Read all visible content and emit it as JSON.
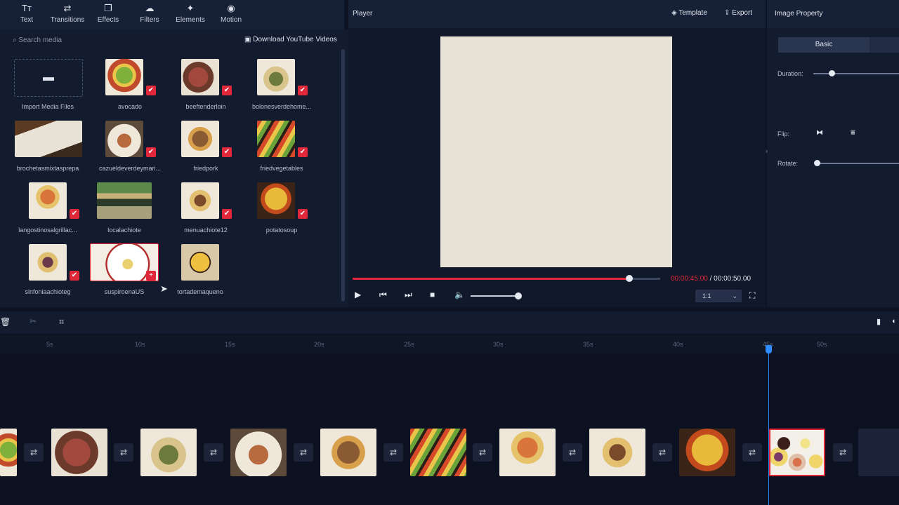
{
  "toolbar": {
    "items": [
      {
        "label": "Text",
        "icon": "text-icon"
      },
      {
        "label": "Transitions",
        "icon": "transitions-icon"
      },
      {
        "label": "Effects",
        "icon": "effects-icon"
      },
      {
        "label": "Filters",
        "icon": "filters-icon"
      },
      {
        "label": "Elements",
        "icon": "elements-icon"
      },
      {
        "label": "Motion",
        "icon": "motion-icon"
      }
    ]
  },
  "media": {
    "search_placeholder": "Search media",
    "download_link": "Download YouTube Videos",
    "import_label": "Import Media Files",
    "items": [
      {
        "label": "avocado",
        "checked": true
      },
      {
        "label": "beeftenderloin",
        "checked": true
      },
      {
        "label": "bolonesverdehome...",
        "checked": true
      },
      {
        "label": "brochetasmixtasprepa",
        "checked": false
      },
      {
        "label": "cazueldeverdeymari...",
        "checked": true
      },
      {
        "label": "friedpork",
        "checked": true
      },
      {
        "label": "friedvegetables",
        "checked": true
      },
      {
        "label": "langostinosalgrillac...",
        "checked": true
      },
      {
        "label": "localachiote",
        "checked": false
      },
      {
        "label": "menuachiote12",
        "checked": true
      },
      {
        "label": "potatosoup",
        "checked": true
      },
      {
        "label": "sinfoniaachioteg",
        "checked": true
      },
      {
        "label": "suspiroenaUS",
        "checked": false
      },
      {
        "label": "tortademaqueno",
        "checked": false
      }
    ]
  },
  "player": {
    "title": "Player",
    "template_label": "Template",
    "export_label": "Export",
    "current_time": "00:00:45.00",
    "separator": "/",
    "total_time": "00:00:50.00",
    "progress": 0.9,
    "volume": 0.95,
    "ratio": "1:1"
  },
  "properties": {
    "title": "Image Property",
    "tab_basic": "Basic",
    "duration_label": "Duration:",
    "flip_label": "Flip:",
    "rotate_label": "Rotate:"
  },
  "timeline": {
    "ticks": [
      "5s",
      "10s",
      "15s",
      "20s",
      "25s",
      "30s",
      "35s",
      "40s",
      "45s",
      "50s"
    ]
  },
  "colors": {
    "accent": "#e0283a",
    "playhead": "#2f8cff",
    "background": "#0d1322"
  }
}
